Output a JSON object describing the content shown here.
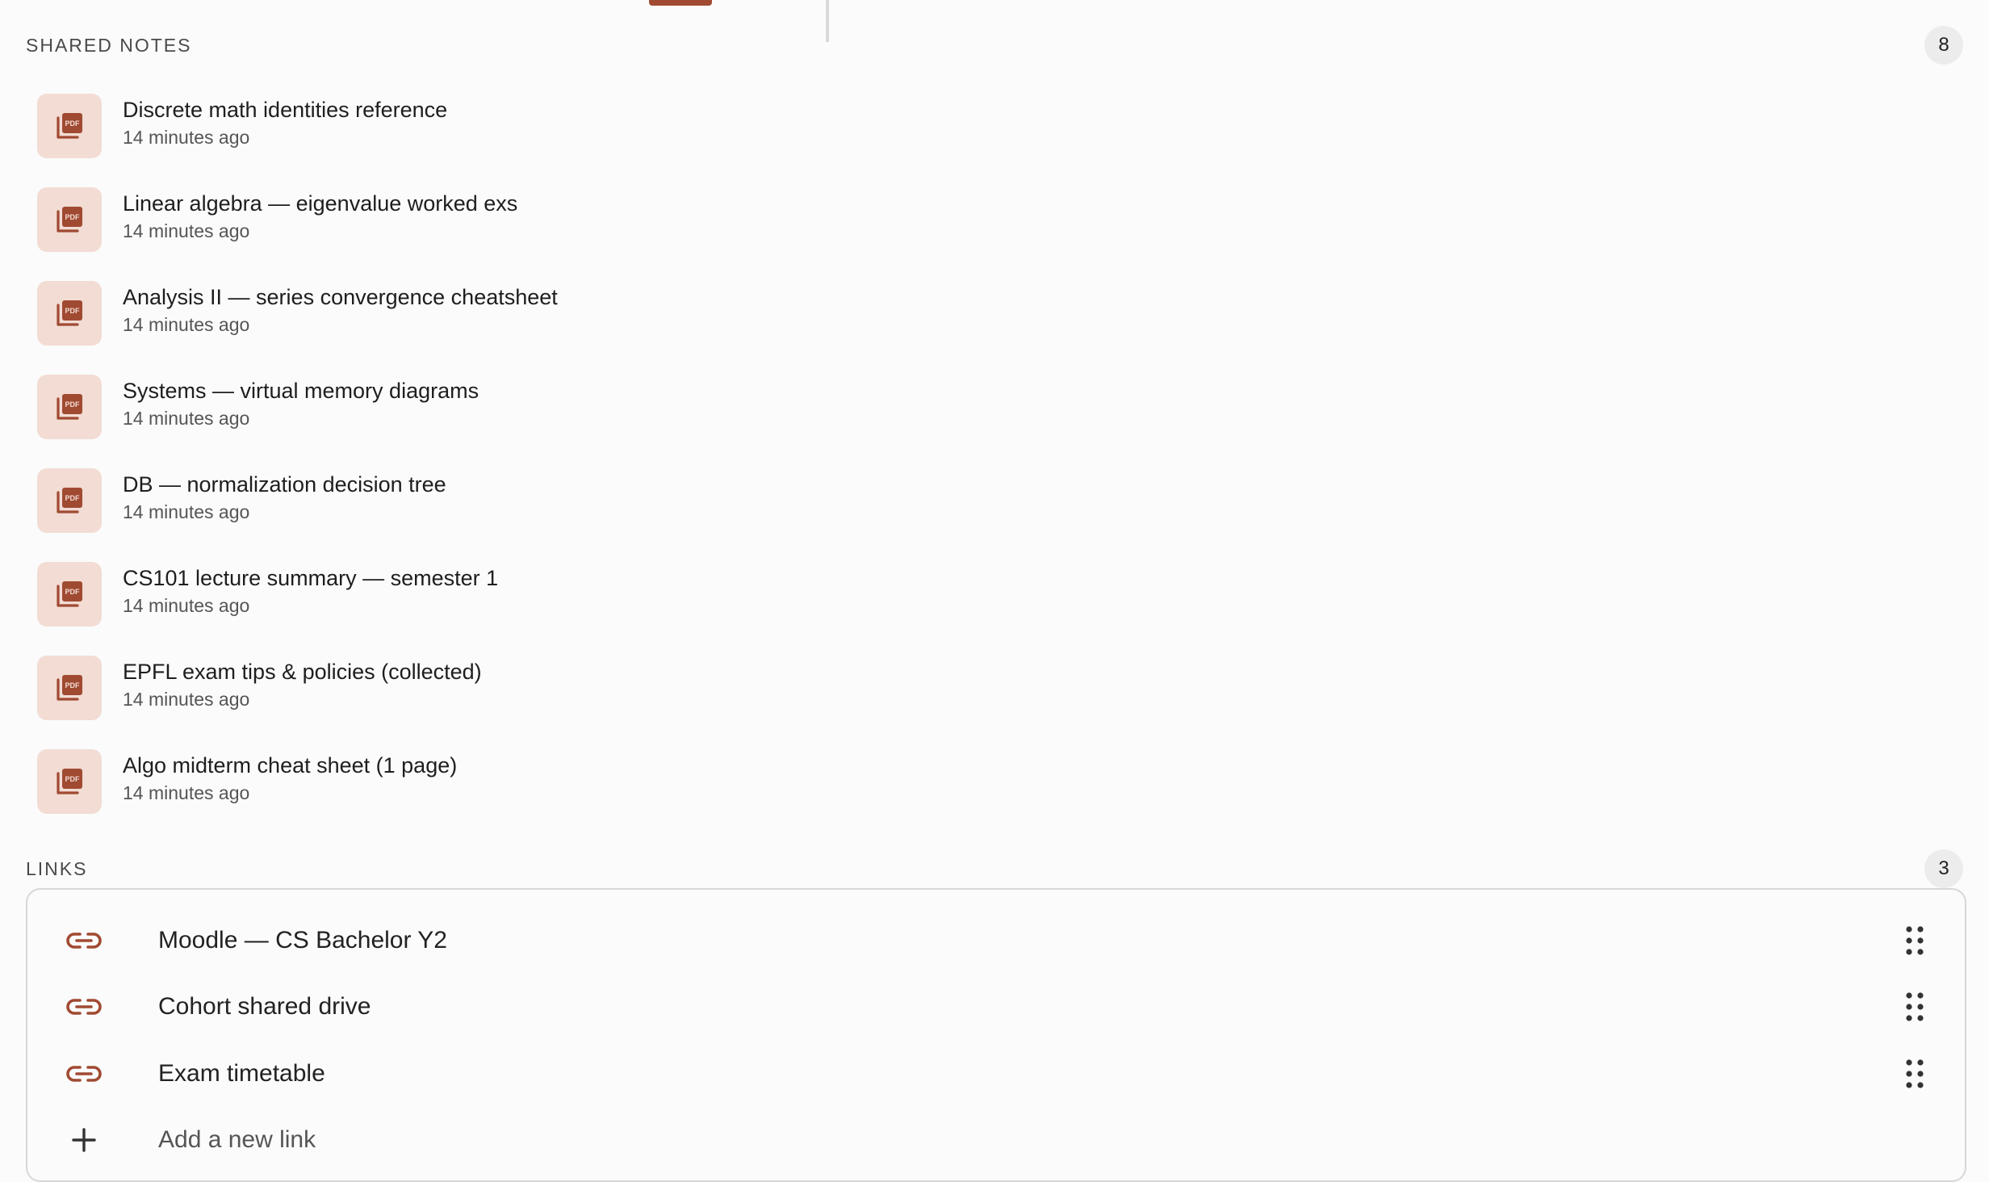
{
  "shared_notes": {
    "title": "SHARED NOTES",
    "count": "8",
    "items": [
      {
        "title": "Discrete math identities reference",
        "meta": "14 minutes ago",
        "icon": "pdf-icon"
      },
      {
        "title": "Linear algebra — eigenvalue worked exs",
        "meta": "14 minutes ago",
        "icon": "pdf-icon"
      },
      {
        "title": "Analysis II — series convergence cheatsheet",
        "meta": "14 minutes ago",
        "icon": "pdf-icon"
      },
      {
        "title": "Systems — virtual memory diagrams",
        "meta": "14 minutes ago",
        "icon": "pdf-icon"
      },
      {
        "title": "DB — normalization decision tree",
        "meta": "14 minutes ago",
        "icon": "pdf-icon"
      },
      {
        "title": "CS101 lecture summary — semester 1",
        "meta": "14 minutes ago",
        "icon": "pdf-icon"
      },
      {
        "title": "EPFL exam tips & policies (collected)",
        "meta": "14 minutes ago",
        "icon": "pdf-icon"
      },
      {
        "title": "Algo midterm cheat sheet (1 page)",
        "meta": "14 minutes ago",
        "icon": "pdf-icon"
      }
    ]
  },
  "links": {
    "title": "LINKS",
    "count": "3",
    "items": [
      {
        "label": "Moodle — CS Bachelor Y2",
        "icon": "link-icon"
      },
      {
        "label": "Cohort shared drive",
        "icon": "link-icon"
      },
      {
        "label": "Exam timetable",
        "icon": "link-icon"
      }
    ],
    "add_label": "Add a new link"
  },
  "colors": {
    "accent": "#a04a32",
    "pdf_tile_bg": "#f2dcd4",
    "background": "#fbfbfb"
  }
}
